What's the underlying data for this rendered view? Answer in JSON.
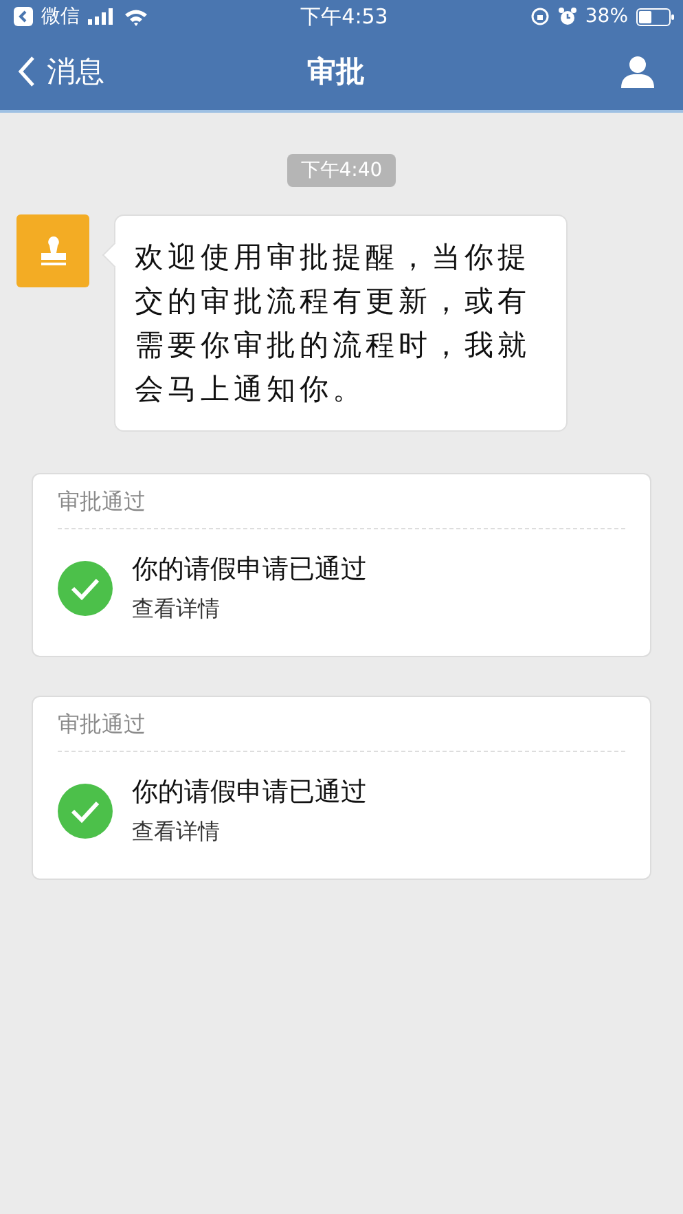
{
  "status_bar": {
    "back_app": "微信",
    "time": "下午4:53",
    "battery": "38%"
  },
  "nav": {
    "back": "消息",
    "title": "审批"
  },
  "timestamp": "下午4:40",
  "message": {
    "text": "欢迎使用审批提醒，当你提交的审批流程有更新，或有需要你审批的流程时，我就会马上通知你。"
  },
  "cards": [
    {
      "header": "审批通过",
      "title": "你的请假申请已通过",
      "link": "查看详情"
    },
    {
      "header": "审批通过",
      "title": "你的请假申请已通过",
      "link": "查看详情"
    }
  ]
}
